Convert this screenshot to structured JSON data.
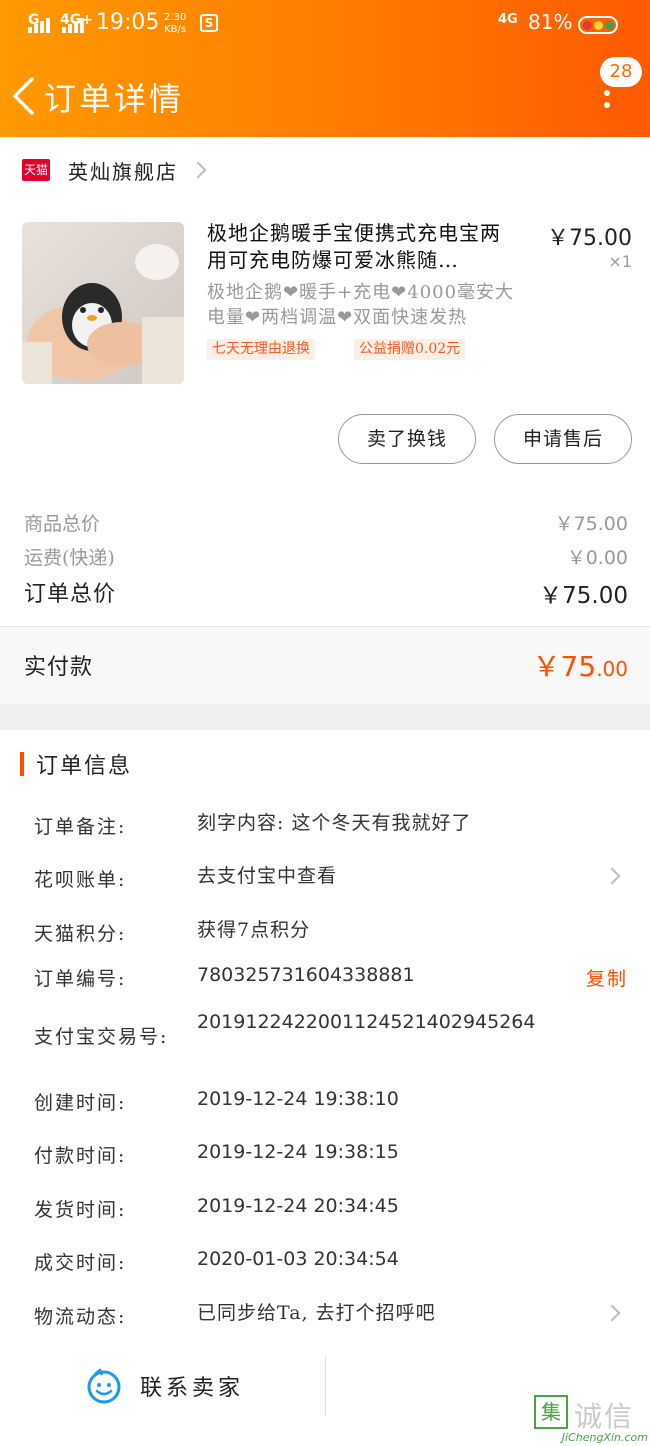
{
  "status_bar": {
    "sim1": "G",
    "sim2": "4G+",
    "time": "19:05",
    "speed_value": "2.30",
    "speed_unit": "KB/s",
    "network": "4G",
    "battery": "81%"
  },
  "header": {
    "title": "订单详情",
    "badge_count": "28"
  },
  "shop": {
    "badge": "天猫",
    "name": "英灿旗舰店"
  },
  "product": {
    "title": "极地企鹅暖手宝便携式充电宝两用可充电防爆可爱冰熊随…",
    "price": "￥75.00",
    "quantity": "×1",
    "subtitle": "极地企鹅❤暖手+充电❤4000毫安大电量❤两档调温❤双面快速发热",
    "tags": [
      "七天无理由退换",
      "公益捐赠0.02元"
    ]
  },
  "actions": {
    "sell_button": "卖了换钱",
    "aftersale_button": "申请售后"
  },
  "summary": {
    "goods_total_label": "商品总价",
    "goods_total_value": "￥75.00",
    "shipping_label": "运费(快递)",
    "shipping_value": "￥0.00",
    "order_total_label": "订单总价",
    "order_total_value": "￥75.00",
    "paid_label": "实付款",
    "paid_value_main": "￥75",
    "paid_value_decimal": ".00"
  },
  "order_info": {
    "title": "订单信息",
    "rows": [
      {
        "label": "订单备注:",
        "value": "刻字内容: 这个冬天有我就好了"
      },
      {
        "label": "花呗账单:",
        "value": "去支付宝中查看"
      },
      {
        "label": "天猫积分:",
        "value": "获得7点积分"
      },
      {
        "label": "订单编号:",
        "value": "780325731604338881"
      },
      {
        "label": "支付宝交易号:",
        "value": "2019122422001124521402945264"
      },
      {
        "label": "创建时间:",
        "value": "2019-12-24 19:38:10"
      },
      {
        "label": "付款时间:",
        "value": "2019-12-24 19:38:15"
      },
      {
        "label": "发货时间:",
        "value": "2019-12-24 20:34:45"
      },
      {
        "label": "成交时间:",
        "value": "2020-01-03 20:34:54"
      },
      {
        "label": "物流动态:",
        "value": "已同步给Ta, 去打个招呼吧"
      }
    ],
    "copy_label": "复制"
  },
  "bottom_bar": {
    "contact_seller": "联系卖家"
  },
  "watermark": {
    "badge": "集",
    "text": "诚信",
    "url": "JiChengXin.com"
  },
  "colors": {
    "brand_orange": "#ff7a00",
    "price_red": "#ff5000",
    "tmall_red": "#e4002b"
  }
}
